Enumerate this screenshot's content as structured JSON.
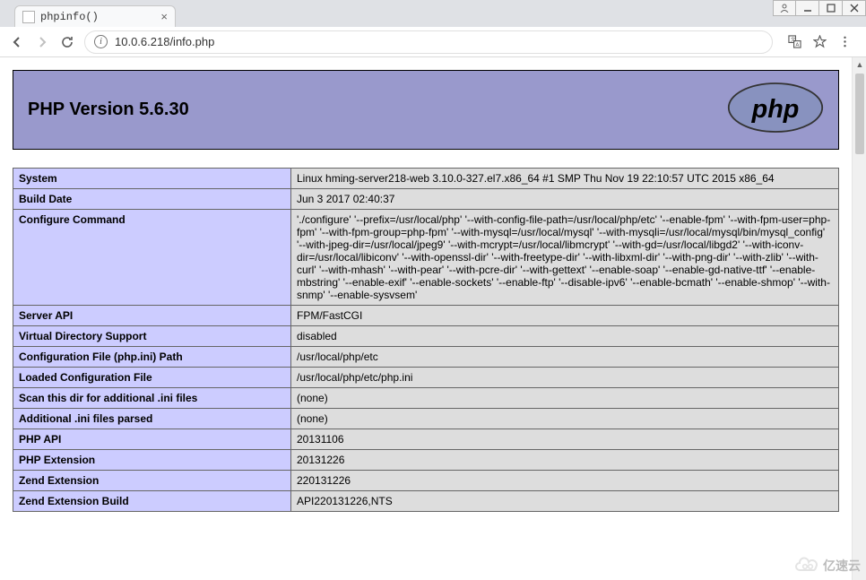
{
  "window": {
    "buttons": [
      "user-icon",
      "minimize",
      "maximize",
      "close"
    ]
  },
  "browser": {
    "tab_title": "phpinfo()",
    "address": "10.0.6.218/info.php"
  },
  "header": {
    "title": "PHP Version 5.6.30",
    "logo_alt": "php"
  },
  "rows": [
    {
      "name": "System",
      "value": "Linux hming-server218-web 3.10.0-327.el7.x86_64 #1 SMP Thu Nov 19 22:10:57 UTC 2015 x86_64"
    },
    {
      "name": "Build Date",
      "value": "Jun 3 2017 02:40:37"
    },
    {
      "name": "Configure Command",
      "value": "'./configure' '--prefix=/usr/local/php' '--with-config-file-path=/usr/local/php/etc' '--enable-fpm' '--with-fpm-user=php-fpm' '--with-fpm-group=php-fpm' '--with-mysql=/usr/local/mysql' '--with-mysqli=/usr/local/mysql/bin/mysql_config' '--with-jpeg-dir=/usr/local/jpeg9' '--with-mcrypt=/usr/local/libmcrypt' '--with-gd=/usr/local/libgd2' '--with-iconv-dir=/usr/local/libiconv' '--with-openssl-dir' '--with-freetype-dir' '--with-libxml-dir' '--with-png-dir' '--with-zlib' '--with-curl' '--with-mhash' '--with-pear' '--with-pcre-dir' '--with-gettext' '--enable-soap' '--enable-gd-native-ttf' '--enable-mbstring' '--enable-exif' '--enable-sockets' '--enable-ftp' '--disable-ipv6' '--enable-bcmath' '--enable-shmop' '--with-snmp' '--enable-sysvsem'"
    },
    {
      "name": "Server API",
      "value": "FPM/FastCGI"
    },
    {
      "name": "Virtual Directory Support",
      "value": "disabled"
    },
    {
      "name": "Configuration File (php.ini) Path",
      "value": "/usr/local/php/etc"
    },
    {
      "name": "Loaded Configuration File",
      "value": "/usr/local/php/etc/php.ini"
    },
    {
      "name": "Scan this dir for additional .ini files",
      "value": "(none)"
    },
    {
      "name": "Additional .ini files parsed",
      "value": "(none)"
    },
    {
      "name": "PHP API",
      "value": "20131106"
    },
    {
      "name": "PHP Extension",
      "value": "20131226"
    },
    {
      "name": "Zend Extension",
      "value": "220131226"
    },
    {
      "name": "Zend Extension Build",
      "value": "API220131226,NTS"
    }
  ],
  "watermark": {
    "text": "亿速云"
  }
}
